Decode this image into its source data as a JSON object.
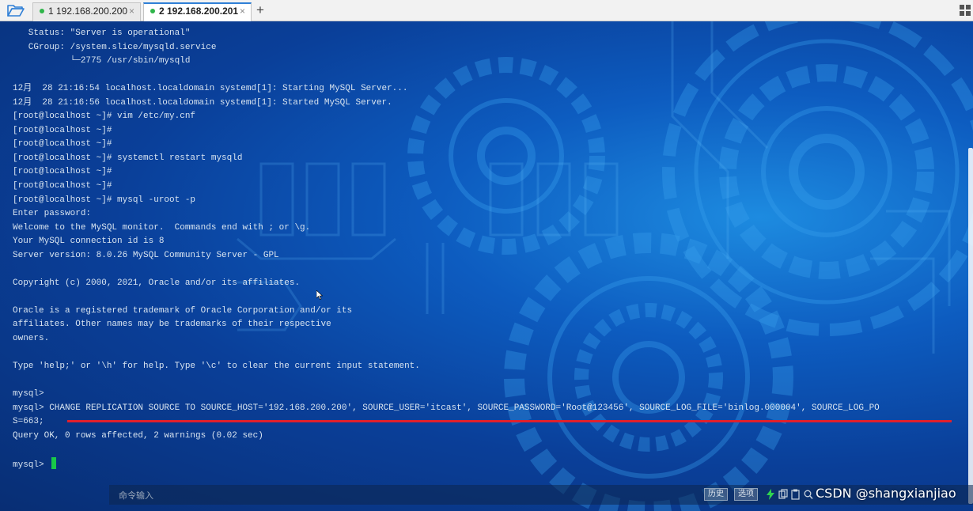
{
  "tabs": [
    {
      "label": "1 192.168.200.200",
      "close": "×",
      "status_color": "#2fb54a"
    },
    {
      "label": "2 192.168.200.201",
      "close": "×",
      "status_color": "#2fb54a",
      "active": true
    }
  ],
  "add_tab_label": "+",
  "terminal": {
    "lines": [
      "   Status: \"Server is operational\"",
      "   CGroup: /system.slice/mysqld.service",
      "           └─2775 /usr/sbin/mysqld",
      "",
      "12月  28 21:16:54 localhost.localdomain systemd[1]: Starting MySQL Server...",
      "12月  28 21:16:56 localhost.localdomain systemd[1]: Started MySQL Server.",
      "[root@localhost ~]# vim /etc/my.cnf",
      "[root@localhost ~]#",
      "[root@localhost ~]#",
      "[root@localhost ~]# systemctl restart mysqld",
      "[root@localhost ~]#",
      "[root@localhost ~]#",
      "[root@localhost ~]# mysql -uroot -p",
      "Enter password:",
      "Welcome to the MySQL monitor.  Commands end with ; or \\g.",
      "Your MySQL connection id is 8",
      "Server version: 8.0.26 MySQL Community Server - GPL",
      "",
      "Copyright (c) 2000, 2021, Oracle and/or its affiliates.",
      "",
      "Oracle is a registered trademark of Oracle Corporation and/or its",
      "affiliates. Other names may be trademarks of their respective",
      "owners.",
      "",
      "Type 'help;' or '\\h' for help. Type '\\c' to clear the current input statement.",
      "",
      "mysql>",
      "mysql> CHANGE REPLICATION SOURCE TO SOURCE_HOST='192.168.200.200', SOURCE_USER='itcast', SOURCE_PASSWORD='Root@123456', SOURCE_LOG_FILE='binlog.000004', SOURCE_LOG_PO",
      "S=663;",
      "Query OK, 0 rows affected, 2 warnings (0.02 sec)",
      ""
    ],
    "prompt": "mysql> ",
    "cursor_color": "#18c948",
    "highlight_color": "#e0202c"
  },
  "command_bar": {
    "placeholder": "命令输入",
    "history_label": "历史",
    "options_label": "选项"
  },
  "watermark": "CSDN @shangxianjiao"
}
